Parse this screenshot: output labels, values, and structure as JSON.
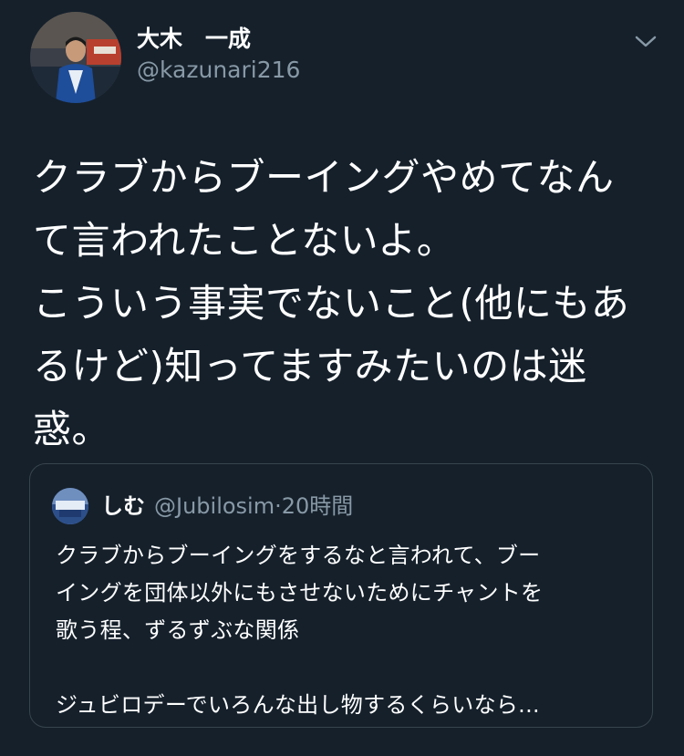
{
  "author": {
    "display_name": "大木　一成",
    "handle": "@kazunari216"
  },
  "tweet": {
    "lines": [
      "クラブからブーイングやめてなん",
      "て言われたことないよ。",
      "こういう事実でないこと(他にもあ",
      "るけど)知ってますみたいのは迷",
      "惑。"
    ]
  },
  "quote": {
    "display_name": "しむ",
    "handle": "@Jubilosim",
    "separator": "·",
    "time": "20時間",
    "lines": [
      "クラブからブーイングをするなと言われて、ブー",
      "イングを団体以外にもさせないためにチャントを",
      "歌う程、ずるずぶな関係"
    ],
    "last_line": "ジュビロデーでいろんな出し物するくらいなら..."
  },
  "icons": {
    "menu": "chevron-down-icon"
  },
  "colors": {
    "background": "#15202b",
    "secondary_text": "#8899a6",
    "border": "#38444d"
  }
}
